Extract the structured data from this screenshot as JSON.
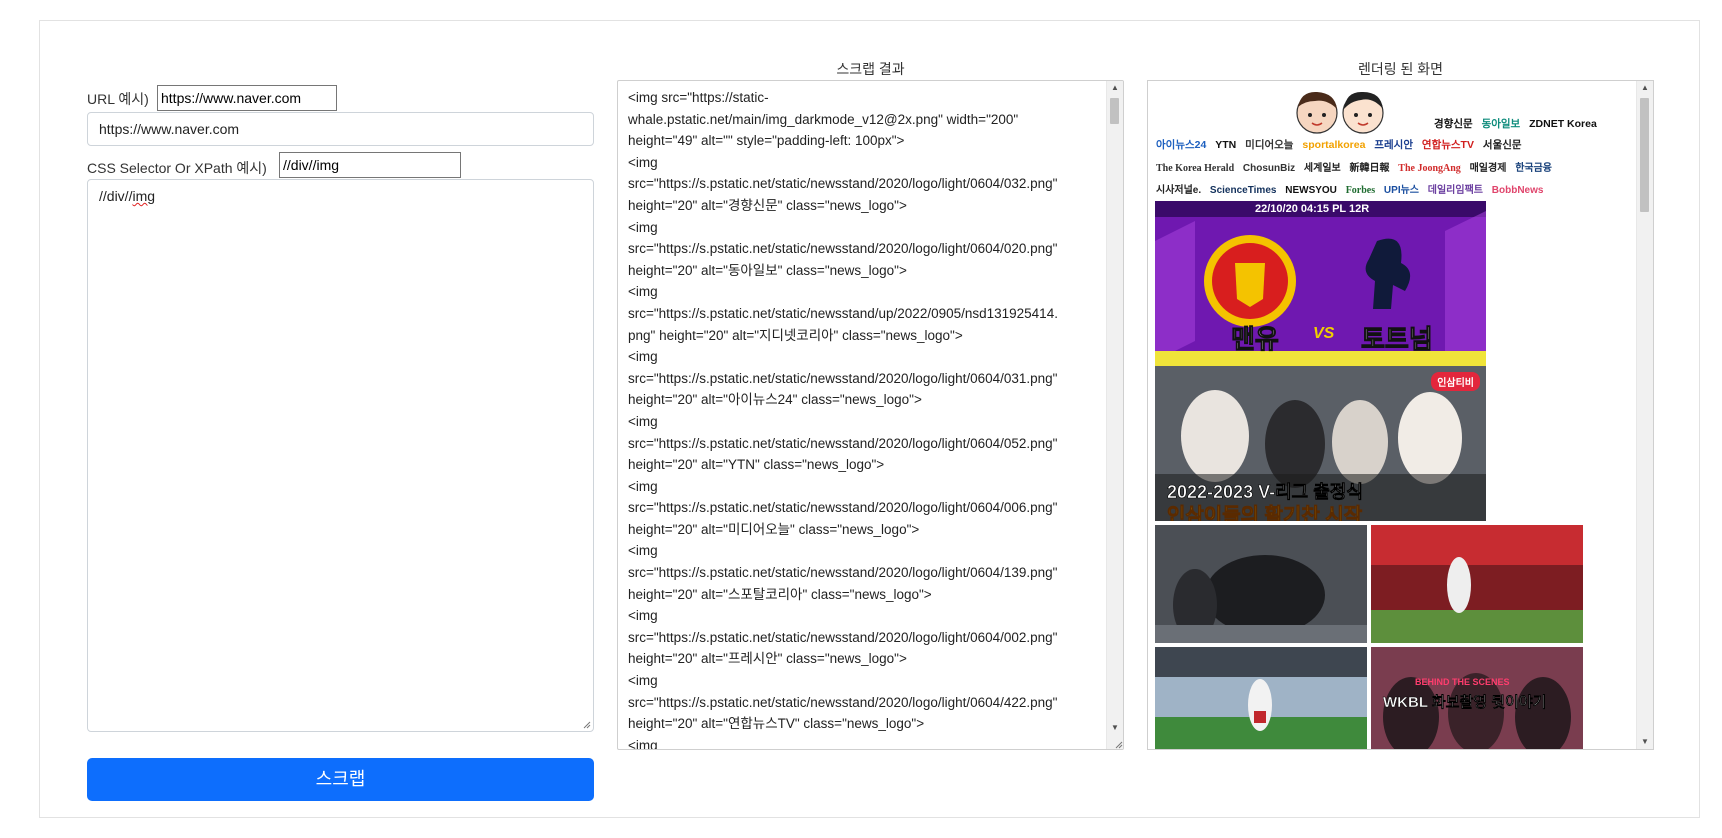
{
  "form": {
    "url_label": "URL 예시)",
    "url_example": "https://www.naver.com",
    "url_value": "https://www.naver.com",
    "selector_label": "CSS Selector Or XPath 예시)",
    "selector_example": "//div//img",
    "selector_prefix": "//div//",
    "selector_suffix": "img",
    "submit_label": "스크랩"
  },
  "result": {
    "title": "스크랩 결과",
    "lines": [
      "<img src=\"https://static-",
      "whale.pstatic.net/main/img_darkmode_v12@2x.png\" width=\"200\"",
      "height=\"49\" alt=\"\" style=\"padding-left: 100px\">",
      "<img",
      "src=\"https://s.pstatic.net/static/newsstand/2020/logo/light/0604/032.png\"",
      "height=\"20\" alt=\"경향신문\" class=\"news_logo\">",
      "<img",
      "src=\"https://s.pstatic.net/static/newsstand/2020/logo/light/0604/020.png\"",
      "height=\"20\" alt=\"동아일보\" class=\"news_logo\">",
      "<img",
      "src=\"https://s.pstatic.net/static/newsstand/up/2022/0905/nsd131925414.",
      "png\" height=\"20\" alt=\"지디넷코리아\" class=\"news_logo\">",
      "<img",
      "src=\"https://s.pstatic.net/static/newsstand/2020/logo/light/0604/031.png\"",
      "height=\"20\" alt=\"아이뉴스24\" class=\"news_logo\">",
      "<img",
      "src=\"https://s.pstatic.net/static/newsstand/2020/logo/light/0604/052.png\"",
      "height=\"20\" alt=\"YTN\" class=\"news_logo\">",
      "<img",
      "src=\"https://s.pstatic.net/static/newsstand/2020/logo/light/0604/006.png\"",
      "height=\"20\" alt=\"미디어오늘\" class=\"news_logo\">",
      "<img",
      "src=\"https://s.pstatic.net/static/newsstand/2020/logo/light/0604/139.png\"",
      "height=\"20\" alt=\"스포탈코리아\" class=\"news_logo\">",
      "<img",
      "src=\"https://s.pstatic.net/static/newsstand/2020/logo/light/0604/002.png\"",
      "height=\"20\" alt=\"프레시안\" class=\"news_logo\">",
      "<img",
      "src=\"https://s.pstatic.net/static/newsstand/2020/logo/light/0604/422.png\"",
      "height=\"20\" alt=\"연합뉴스TV\" class=\"news_logo\">",
      "<img"
    ]
  },
  "render": {
    "title": "렌더링 된 화면",
    "logos_row1": [
      "경향신문",
      "동아일보",
      "ZDNET Korea"
    ],
    "logos_row2": [
      "아이뉴스24",
      "YTN",
      "미디어오늘",
      "sportalkorea",
      "프레시안",
      "연합뉴스TV",
      "서울신문"
    ],
    "logos_row3": [
      "The Korea Herald",
      "ChosunBiz",
      "세계일보",
      "新韓日報",
      "The JoongAng",
      "매일경제",
      "한국금융"
    ],
    "logos_row4": [
      "시사저널e.",
      "ScienceTimes",
      "NEWSYOU",
      "Forbes",
      "UPI뉴스",
      "데일리임팩트",
      "BobbNews"
    ],
    "banner_time": "22/10/20 04:15 PL 12R",
    "banner_team1": "맨유",
    "banner_vs": "VS",
    "banner_team2": "토트넘",
    "volley_badge": "인삼티비",
    "volley_caption": "2022-2023 V-리그 출정식",
    "volley_subcaption": "인삼이들의 활기찬 시작",
    "wkbl_caption": "WKBL 화보촬영 뒷이야기",
    "wkbl_top": "BEHIND THE SCENES"
  },
  "colors": {
    "accent": "#0d6efd",
    "banner_purple": "#7a1fb8",
    "banner_red": "#c8102e"
  }
}
